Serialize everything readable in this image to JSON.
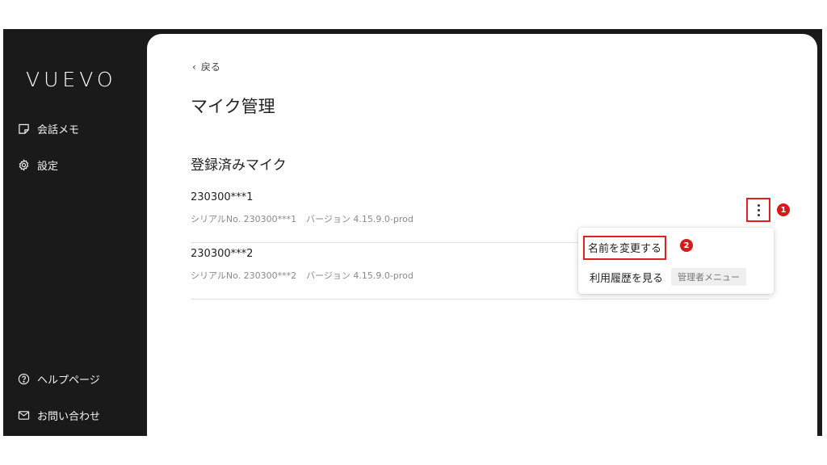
{
  "sidebar": {
    "logo": "VUEVO",
    "items": [
      {
        "label": "会話メモ",
        "icon": "note-icon"
      },
      {
        "label": "設定",
        "icon": "gear-icon"
      }
    ],
    "footer_items": [
      {
        "label": "ヘルプページ",
        "icon": "help-circle-icon"
      },
      {
        "label": "お問い合わせ",
        "icon": "mail-icon"
      }
    ]
  },
  "main": {
    "back_label": "戻る",
    "page_title": "マイク管理",
    "section_title": "登録済みマイク",
    "mics": [
      {
        "name": "230300***1",
        "serial": "シリアルNo. 230300***1",
        "version": "バージョン 4.15.9.0-prod"
      },
      {
        "name": "230300***2",
        "serial": "シリアルNo. 230300***2",
        "version": "バージョン 4.15.9.0-prod"
      }
    ]
  },
  "context_menu": {
    "rename_label": "名前を変更する",
    "history_label": "利用履歴を見る",
    "admin_badge": "管理者メニュー"
  },
  "annotations": {
    "step1": "1",
    "step2": "2"
  },
  "colors": {
    "sidebar_bg": "#1a1a1a",
    "highlight": "#e0201a",
    "logo_accent": "#2fd0e0"
  }
}
